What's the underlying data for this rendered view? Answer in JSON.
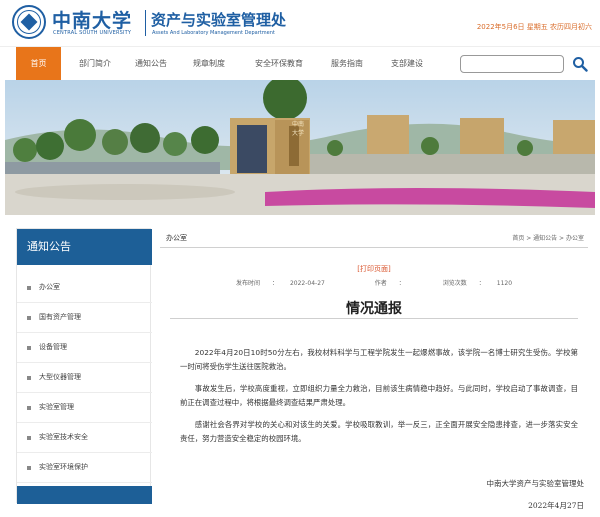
{
  "header": {
    "school_name_cn": "中南大学",
    "school_name_en": "CENTRAL SOUTH UNIVERSITY",
    "dept_name_cn": "资产与实验室管理处",
    "dept_name_en": "Assets And Laboratory Management Department",
    "date_text": "2022年5月6日 星期五 农历四月初六"
  },
  "nav": {
    "items": [
      {
        "label": "首页"
      },
      {
        "label": "部门简介"
      },
      {
        "label": "通知公告"
      },
      {
        "label": "规章制度"
      },
      {
        "label": "安全环保教育"
      },
      {
        "label": "服务指南"
      },
      {
        "label": "支部建设"
      }
    ],
    "search_placeholder": "",
    "search_icon": "search-icon"
  },
  "banner": {
    "gate_text": "中南大学"
  },
  "sidebar": {
    "title": "通知公告",
    "items": [
      {
        "label": "办公室"
      },
      {
        "label": "国有资产管理"
      },
      {
        "label": "设备管理"
      },
      {
        "label": "大型仪器管理"
      },
      {
        "label": "实验室管理"
      },
      {
        "label": "实验室技术安全"
      },
      {
        "label": "实验室环境保护"
      }
    ]
  },
  "content": {
    "section_title": "办公室",
    "breadcrumb": "首页 > 通知公告 > 办公室",
    "print_label": "[打印页面]",
    "meta": {
      "published_label": "发布时间",
      "published_value": "2022-04-27",
      "author_label": "作者",
      "views_label": "浏览次数",
      "views_value": "1120"
    },
    "article_title": "情况通报",
    "paragraphs": [
      "2022年4月20日10时50分左右，我校材料科学与工程学院发生一起爆燃事故，该学院一名博士研究生受伤。学校第一时间将受伤学生送往医院救治。",
      "事故发生后，学校高度重视，立即组织力量全力救治，目前该生病情稳中趋好。与此同时，学校启动了事故调查，目前正在调查过程中，将根据最终调查结果严肃处理。",
      "感谢社会各界对学校的关心和对该生的关爱。学校吸取教训，举一反三，正全面开展安全隐患排查，进一步落实安全责任，努力营造安全稳定的校园环境。"
    ],
    "sign_org": "中南大学资产与实验室管理处",
    "sign_date": "2022年4月27日"
  },
  "colors": {
    "brand_blue": "#1f5fa3",
    "nav_active": "#e8751a",
    "sidebar_blue": "#1d5f97",
    "accent_red": "#d9532b"
  }
}
